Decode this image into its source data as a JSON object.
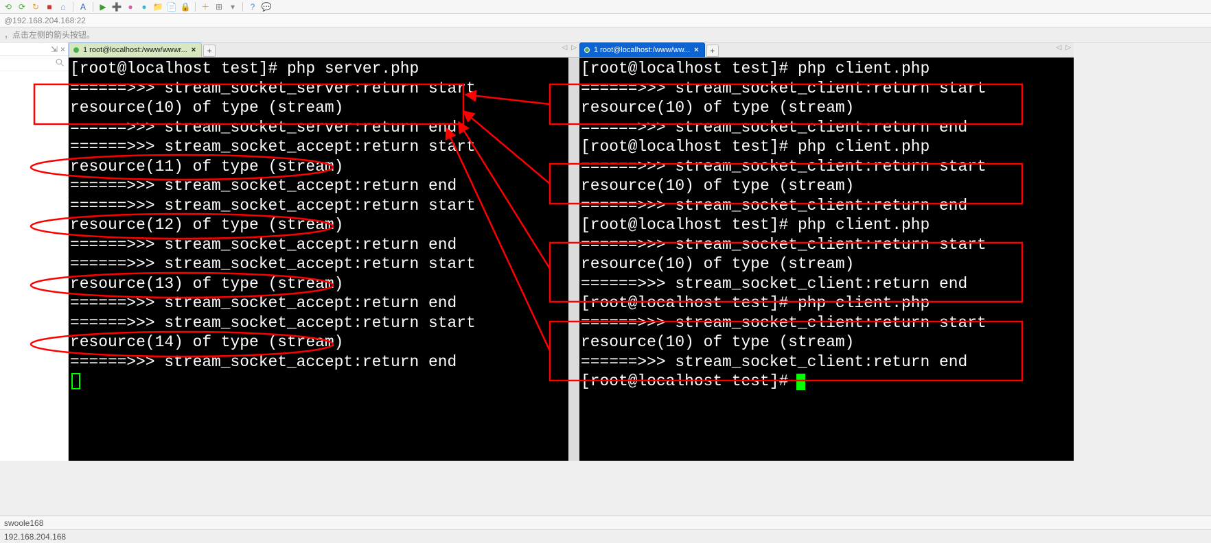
{
  "address": "@192.168.204.168:22",
  "hint": "，点击左侧的箭头按钮。",
  "side_panel": {
    "pin_label": "⇲",
    "close_label": "×",
    "search_icon": "search-icon"
  },
  "left_tab": {
    "title": "1 root@localhost:/www/wwwr..."
  },
  "right_tab": {
    "title": "1 root@localhost:/www/ww..."
  },
  "server_lines": [
    "[root@localhost test]# php server.php",
    "======>>> stream_socket_server:return start",
    "resource(10) of type (stream)",
    "======>>> stream_socket_server:return end",
    "======>>> stream_socket_accept:return start",
    "resource(11) of type (stream)",
    "======>>> stream_socket_accept:return end",
    "======>>> stream_socket_accept:return start",
    "resource(12) of type (stream)",
    "======>>> stream_socket_accept:return end",
    "======>>> stream_socket_accept:return start",
    "resource(13) of type (stream)",
    "======>>> stream_socket_accept:return end",
    "======>>> stream_socket_accept:return start",
    "resource(14) of type (stream)",
    "======>>> stream_socket_accept:return end"
  ],
  "client_lines": [
    "[root@localhost test]# php client.php",
    "======>>> stream_socket_client:return start",
    "resource(10) of type (stream)",
    "======>>> stream_socket_client:return end",
    "[root@localhost test]# php client.php",
    "======>>> stream_socket_client:return start",
    "resource(10) of type (stream)",
    "======>>> stream_socket_client:return end",
    "[root@localhost test]# php client.php",
    "======>>> stream_socket_client:return start",
    "resource(10) of type (stream)",
    "======>>> stream_socket_client:return end",
    "[root@localhost test]# php client.php",
    "======>>> stream_socket_client:return start",
    "resource(10) of type (stream)",
    "======>>> stream_socket_client:return end",
    "[root@localhost test]# "
  ],
  "status": {
    "session_name": "swoole168",
    "host": "192.168.204.168"
  },
  "toolbar_icons": [
    "back-icon",
    "forward-icon",
    "refresh-icon",
    "stop-icon",
    "home-icon",
    "font-icon",
    "play-icon",
    "plus-green-icon",
    "pink-icon",
    "cyan-icon",
    "folder-icon",
    "doc-icon",
    "lock-icon",
    "add-icon",
    "grid-icon",
    "chevron-down-icon",
    "help-icon",
    "chat-icon"
  ],
  "toolbar_glyphs": [
    "⟲",
    "⟳",
    "↻",
    "■",
    "⌂",
    "A",
    "▶",
    "➕",
    "●",
    "●",
    "📁",
    "📄",
    "🔒",
    "＋",
    "⊞",
    "▾",
    "?",
    "💬"
  ],
  "toolbar_colors": [
    "#5fa94f",
    "#5fa94f",
    "#e1a23a",
    "#c33",
    "#5f8fd4",
    "#2a60b0",
    "#33a02c",
    "#33a02c",
    "#d85fa4",
    "#3fbcd0",
    "#dca54a",
    "#5f8fd4",
    "#dca54a",
    "#dca54a",
    "#888",
    "#888",
    "#4a90d9",
    "#888"
  ]
}
